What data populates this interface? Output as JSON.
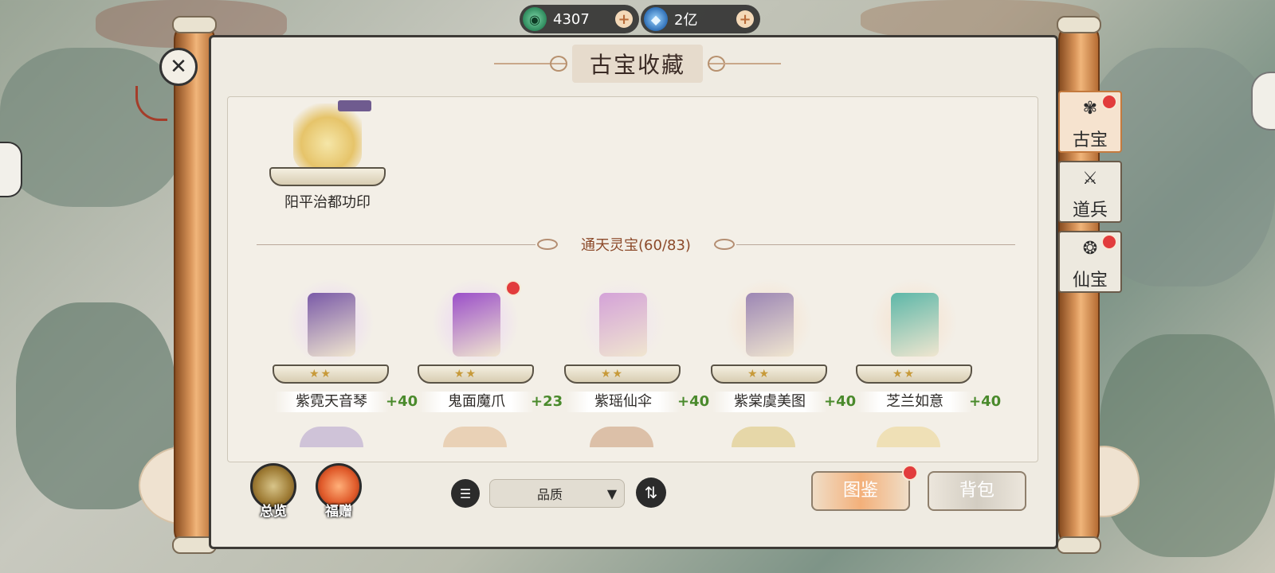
{
  "currency": {
    "jade": {
      "icon": "jade-icon",
      "value": "4307"
    },
    "crystal": {
      "icon": "crystal-icon",
      "value": "2亿"
    },
    "add_glyph": "+"
  },
  "panel": {
    "title": "古宝收藏",
    "close_glyph": "✕"
  },
  "featured": {
    "name": "阳平治都功印"
  },
  "section": {
    "label": "通天灵宝(60/83)"
  },
  "items": [
    {
      "name": "紫霓天音琴",
      "bonus": "+40",
      "stars": "★★",
      "glow": "#e9d2f5",
      "art": "#7a5aa8",
      "new": false
    },
    {
      "name": "鬼面魔爪",
      "bonus": "+23",
      "stars": "★★",
      "glow": "#ead0f6",
      "art": "#9b4fc9",
      "new": true
    },
    {
      "name": "紫瑶仙伞",
      "bonus": "+40",
      "stars": "★★",
      "glow": "#f1e2f1",
      "art": "#d4a2d8",
      "new": false
    },
    {
      "name": "紫棠虞美图",
      "bonus": "+40",
      "stars": "★★",
      "glow": "#f7dfc9",
      "art": "#9c86b4",
      "new": false
    },
    {
      "name": "芝兰如意",
      "bonus": "+40",
      "stars": "★★",
      "glow": "#f7dfc9",
      "art": "#5db7a8",
      "new": false
    }
  ],
  "toolbar": {
    "overview_label": "总览",
    "gift_label": "福赠",
    "filter_glyph": "☰",
    "sort_value": "品质",
    "dropdown_glyph": "▼",
    "sort_glyph": "⇅",
    "catalog_label": "图鉴",
    "bag_label": "背包"
  },
  "tabs": [
    {
      "label": "古宝",
      "icon": "treasure-icon",
      "glyph": "✾",
      "active": true,
      "new": true
    },
    {
      "label": "道兵",
      "icon": "weapon-icon",
      "glyph": "⚔",
      "active": false,
      "new": false
    },
    {
      "label": "仙宝",
      "icon": "immortal-treasure-icon",
      "glyph": "❂",
      "active": false,
      "new": true
    }
  ]
}
